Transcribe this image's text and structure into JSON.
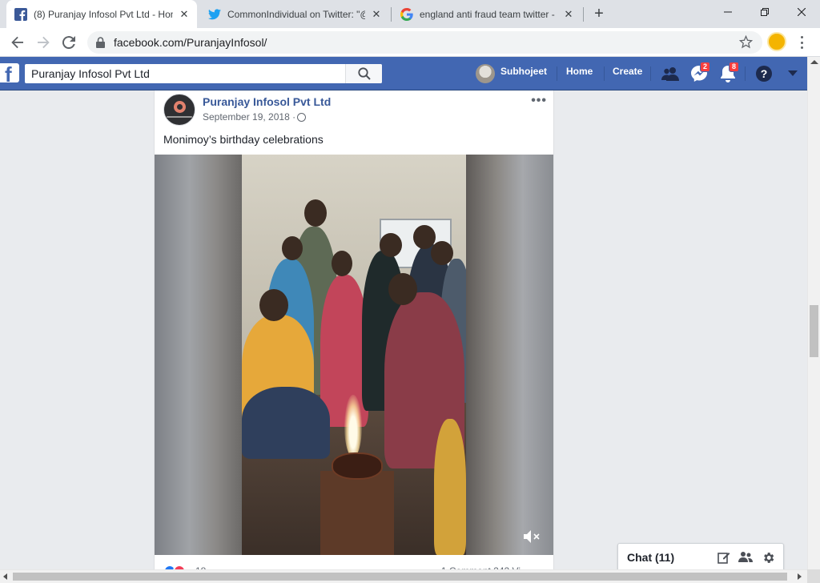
{
  "browser": {
    "tabs": [
      {
        "title": "(8) Puranjay Infosol Pvt Ltd - Hon",
        "icon": "facebook-icon",
        "active": true
      },
      {
        "title": "CommonIndividual on Twitter: \"@",
        "icon": "twitter-icon",
        "active": false
      },
      {
        "title": "england anti fraud team twitter -",
        "icon": "google-icon",
        "active": false
      }
    ],
    "url": "facebook.com/PuranjayInfosol/"
  },
  "facebook": {
    "search_value": "Puranjay Infosol Pvt Ltd",
    "user_name": "Subhojeet",
    "nav": {
      "home": "Home",
      "create": "Create"
    },
    "badges": {
      "messages": "2",
      "notifications": "8"
    },
    "colors": {
      "brand": "#4267b2",
      "badge": "#fa3e3e",
      "link": "#385898"
    }
  },
  "post": {
    "page_name": "Puranjay Infosol Pvt Ltd",
    "date": "September 19, 2018 ·",
    "text": "Monimoy’s birthday celebrations",
    "reaction_count": "18",
    "comments_views": "1 Comment  242 Vi"
  },
  "chat": {
    "label": "Chat (11)"
  }
}
